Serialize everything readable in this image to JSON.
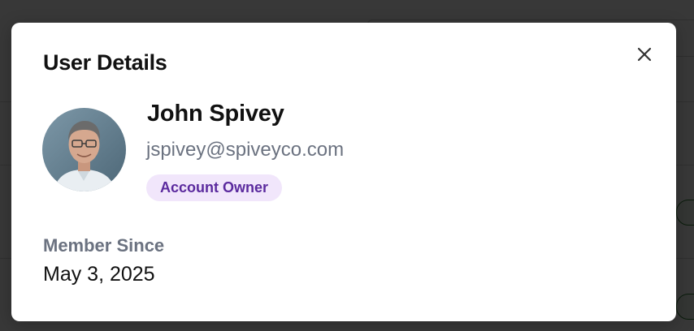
{
  "modal": {
    "title": "User Details",
    "close_icon": "close-icon",
    "user": {
      "name": "John Spivey",
      "email": "jspivey@spiveyco.com",
      "role_badge": "Account Owner",
      "avatar_icon": "avatar-photo"
    },
    "member_since": {
      "label": "Member Since",
      "value": "May 3, 2025"
    }
  },
  "colors": {
    "badge_bg": "#f1e6fb",
    "badge_text": "#5b2a9e",
    "muted_text": "#6b7280",
    "overlay": "#3a3a3a"
  }
}
